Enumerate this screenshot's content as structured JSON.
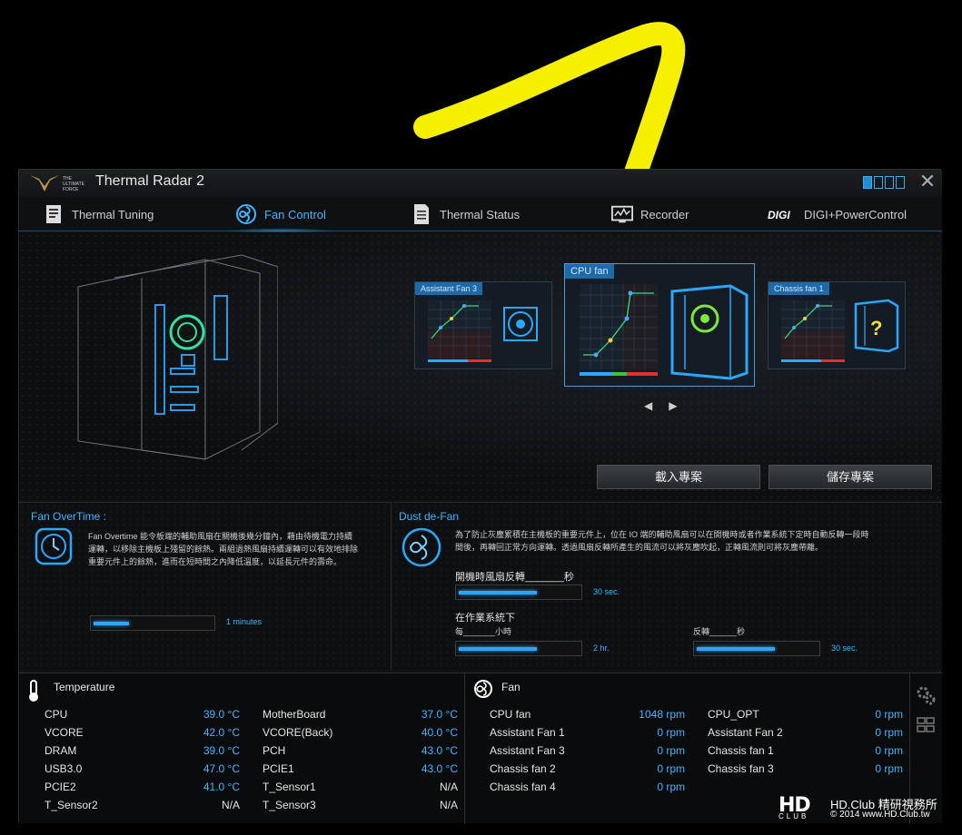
{
  "app": {
    "title": "Thermal Radar 2",
    "logo_text": [
      "THE",
      "ULTIMATE",
      "FORCE"
    ]
  },
  "tabs": [
    {
      "label": "Thermal Tuning",
      "icon": "clipboard-icon"
    },
    {
      "label": "Fan Control",
      "icon": "fan-swirl-icon"
    },
    {
      "label": "Thermal Status",
      "icon": "document-icon"
    },
    {
      "label": "Recorder",
      "icon": "monitor-chart-icon"
    },
    {
      "label": "DIGI+PowerControl",
      "icon": "digi-logo-icon",
      "logo_text": "DIGI"
    }
  ],
  "fan_cards": {
    "assistant_fan3": "Assistant Fan 3",
    "cpu_fan": "CPU fan",
    "chassis_fan1": "Chassis fan 1",
    "chassis_question": "?"
  },
  "buttons": {
    "load_profile": "載入專案",
    "save_profile": "儲存專案"
  },
  "fan_overtime": {
    "title": "Fan OverTime :",
    "desc_lines": [
      "Fan Overtime 能令板端的輔助風扇在關機後幾分鐘內，藉由待機電力持續",
      "運轉，以移除主機板上殘留的餘熱。兩組過熱風扇持續運轉可以有效地排除",
      "重要元件上的餘熱，進而在短時間之內降低溫度，以延長元件的壽命。"
    ],
    "value": "1 minutes",
    "level": 0.3
  },
  "dust_defan": {
    "title": "Dust de-Fan",
    "desc_lines": [
      "為了防止灰塵累積在主機板的重要元件上，位在 IO 端的輔助風扇可以在開機時或者作業系統下定時自動反轉一段時",
      "間後，再轉回正常方向運轉。透過風扇反轉所產生的風流可以將灰塵吹起，正轉風流則可將灰塵帶離。"
    ],
    "boot_label": "開機時風扇反轉_______秒",
    "boot_value": "30 sec.",
    "boot_level": 0.65,
    "os_label": "在作業系統下",
    "every_label": "每_______小時",
    "every_value": "2 hr.",
    "every_level": 0.65,
    "reverse_label": "反轉______秒",
    "reverse_value": "30 sec.",
    "reverse_level": 0.65
  },
  "temperature": {
    "title": "Temperature",
    "left": [
      {
        "name": "CPU",
        "value": "39.0 °C"
      },
      {
        "name": "VCORE",
        "value": "42.0 °C"
      },
      {
        "name": "DRAM",
        "value": "39.0 °C"
      },
      {
        "name": "USB3.0",
        "value": "47.0 °C"
      },
      {
        "name": "PCIE2",
        "value": "41.0 °C"
      },
      {
        "name": "T_Sensor2",
        "value": "N/A"
      }
    ],
    "right": [
      {
        "name": "MotherBoard",
        "value": "37.0 °C"
      },
      {
        "name": "VCORE(Back)",
        "value": "40.0 °C"
      },
      {
        "name": "PCH",
        "value": "43.0 °C"
      },
      {
        "name": "PCIE1",
        "value": "43.0 °C"
      },
      {
        "name": "T_Sensor1",
        "value": "N/A"
      },
      {
        "name": "T_Sensor3",
        "value": "N/A"
      }
    ]
  },
  "fan": {
    "title": "Fan",
    "left": [
      {
        "name": "CPU fan",
        "value": "1048  rpm"
      },
      {
        "name": "Assistant Fan 1",
        "value": "0  rpm"
      },
      {
        "name": "Assistant Fan 3",
        "value": "0  rpm"
      },
      {
        "name": "Chassis fan 2",
        "value": "0  rpm"
      },
      {
        "name": "Chassis fan 4",
        "value": "0  rpm"
      }
    ],
    "right": [
      {
        "name": "CPU_OPT",
        "value": "0  rpm"
      },
      {
        "name": "Assistant Fan 2",
        "value": "0  rpm"
      },
      {
        "name": "Chassis fan 1",
        "value": "0  rpm"
      },
      {
        "name": "Chassis fan 3",
        "value": "0  rpm"
      }
    ]
  },
  "watermark": {
    "hd": "HD",
    "club": "CLUB",
    "name": "HD.Club 精研視務所",
    "copy": "© 2014  www.HD.Club.tw"
  },
  "colors": {
    "accent": "#3fb6ff",
    "annotation": "#f5f000"
  }
}
